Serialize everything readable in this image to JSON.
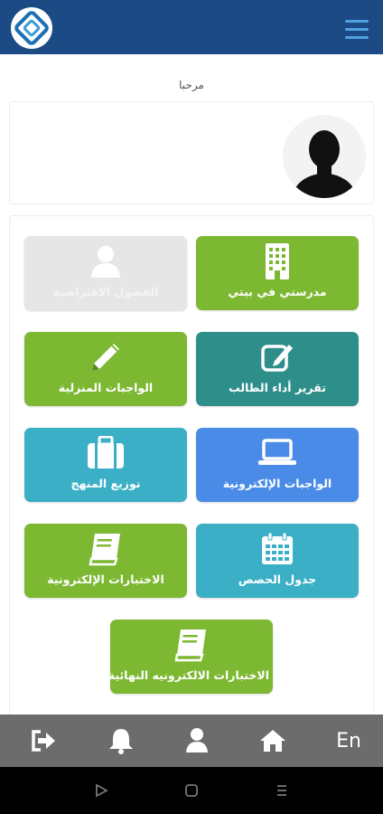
{
  "header": {
    "logo_icon": "app-logo-icon",
    "menu_icon": "hamburger-menu-icon"
  },
  "greeting": "مرحبا",
  "profile": {
    "avatar_icon": "user-silhouette-icon"
  },
  "tiles": [
    {
      "label": "مدرستي في بيتي",
      "icon": "building-icon",
      "color": "#7db832"
    },
    {
      "label": "الفصول الافتراضية",
      "icon": "user-icon",
      "color": "#e6e6e6",
      "state": "disabled"
    },
    {
      "label": "تقرير أداء الطالب",
      "icon": "edit-icon",
      "color": "#2e8f8a"
    },
    {
      "label": "الواجبات المنزلية",
      "icon": "pencil-icon",
      "color": "#7db832"
    },
    {
      "label": "الواجبات الإلكترونية",
      "icon": "laptop-icon",
      "color": "#4a8be8"
    },
    {
      "label": "توزيع المنهج",
      "icon": "suitcase-icon",
      "color": "#3aafc6"
    },
    {
      "label": "جدول الحصص",
      "icon": "calendar-icon",
      "color": "#3aafc6"
    },
    {
      "label": "الاختبارات الإلكترونية",
      "icon": "book-icon",
      "color": "#7db832"
    },
    {
      "label": "الاختبارات الالكترونيه النهائية",
      "icon": "book-icon",
      "color": "#7db832"
    }
  ],
  "bottom_nav": {
    "logout_icon": "sign-out-icon",
    "notifications_icon": "bell-icon",
    "profile_icon": "user-icon",
    "home_icon": "home-icon",
    "language_label": "En"
  },
  "system_nav": {
    "back": "play-triangle-icon",
    "home": "square-icon",
    "recents": "lines-icon"
  }
}
